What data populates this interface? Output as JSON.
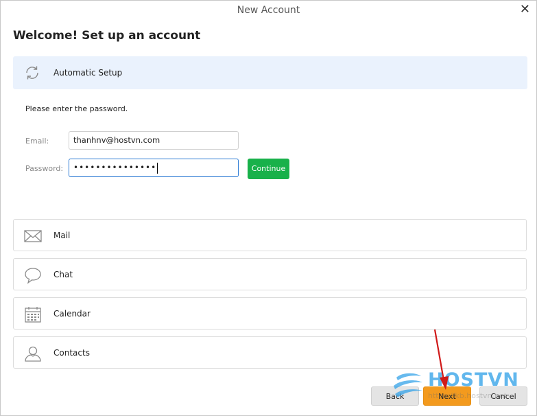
{
  "window": {
    "title": "New Account",
    "close_glyph": "✕"
  },
  "heading": "Welcome! Set up an account",
  "automatic_setup": {
    "label": "Automatic Setup",
    "icon": "refresh-icon"
  },
  "prompt": "Please enter the password.",
  "form": {
    "email_label": "Email:",
    "email_value": "thanhnv@hostvn.com",
    "password_label": "Password:",
    "password_masked": "•••••••••••••••",
    "continue_label": "Continue"
  },
  "services": [
    {
      "label": "Mail",
      "icon": "mail-icon"
    },
    {
      "label": "Chat",
      "icon": "chat-icon"
    },
    {
      "label": "Calendar",
      "icon": "calendar-icon"
    },
    {
      "label": "Contacts",
      "icon": "contacts-icon"
    }
  ],
  "footer": {
    "back_label": "Back",
    "next_label": "Next",
    "cancel_label": "Cancel"
  },
  "watermark": {
    "brand": "HOSTVN",
    "url": "https://kb.hostvn.net"
  },
  "colors": {
    "accent_blue": "#2b7ad4",
    "continue_green": "#18b14a",
    "next_orange": "#f39a1e",
    "setup_bg": "#eaf2fd",
    "arrow_red": "#d01a1a"
  }
}
